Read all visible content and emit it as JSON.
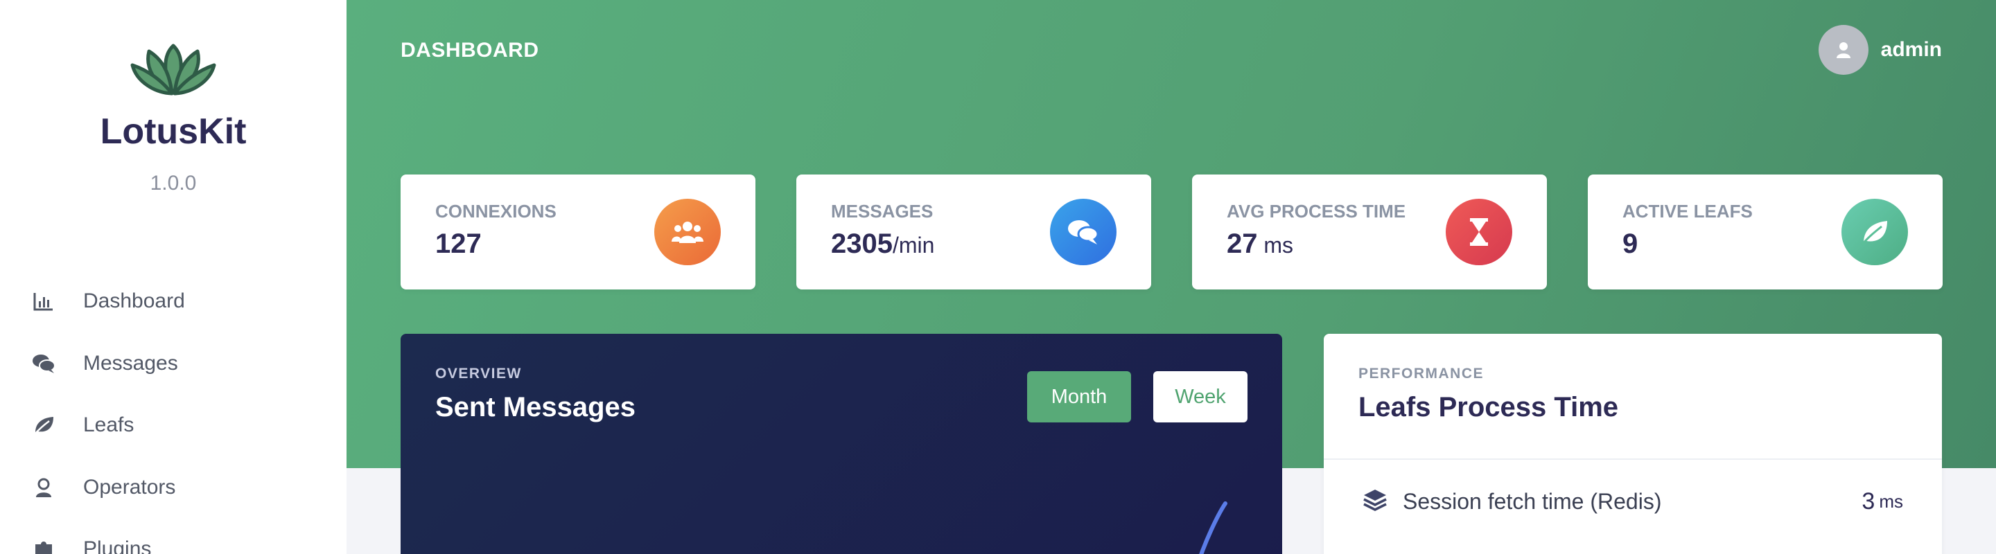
{
  "sidebar": {
    "brand": "LotusKit",
    "version": "1.0.0",
    "items": [
      {
        "label": "Dashboard",
        "icon": "bar-chart-icon"
      },
      {
        "label": "Messages",
        "icon": "chat-icon"
      },
      {
        "label": "Leafs",
        "icon": "leaf-icon"
      },
      {
        "label": "Operators",
        "icon": "operator-icon"
      },
      {
        "label": "Plugins",
        "icon": "puzzle-icon"
      }
    ]
  },
  "header": {
    "title": "DASHBOARD",
    "user": "admin"
  },
  "stats": [
    {
      "label": "CONNEXIONS",
      "value": "127",
      "unit": "",
      "icon": "users-icon",
      "color": "#f07c3d"
    },
    {
      "label": "MESSAGES",
      "value": "2305",
      "unit": "/min",
      "icon": "chat-icon",
      "color": "#2f86e6"
    },
    {
      "label": "AVG PROCESS TIME",
      "value": "27",
      "unit": " ms",
      "icon": "hourglass-icon",
      "color": "#e24a52"
    },
    {
      "label": "ACTIVE LEAFS",
      "value": "9",
      "unit": "",
      "icon": "leaf-icon",
      "color": "#5cbf99"
    }
  ],
  "overview": {
    "subtitle": "OVERVIEW",
    "title": "Sent Messages",
    "buttons": {
      "month": "Month",
      "week": "Week"
    },
    "selected": "Month"
  },
  "performance": {
    "subtitle": "PERFORMANCE",
    "title": "Leafs Process Time",
    "rows": [
      {
        "label": "Session fetch time (Redis)",
        "value": "3",
        "unit": "ms",
        "icon": "layers-icon"
      }
    ]
  },
  "colors": {
    "accent": "#58aa78",
    "brand_text": "#2d2a55",
    "overview_bg": "#1c2a4f"
  }
}
